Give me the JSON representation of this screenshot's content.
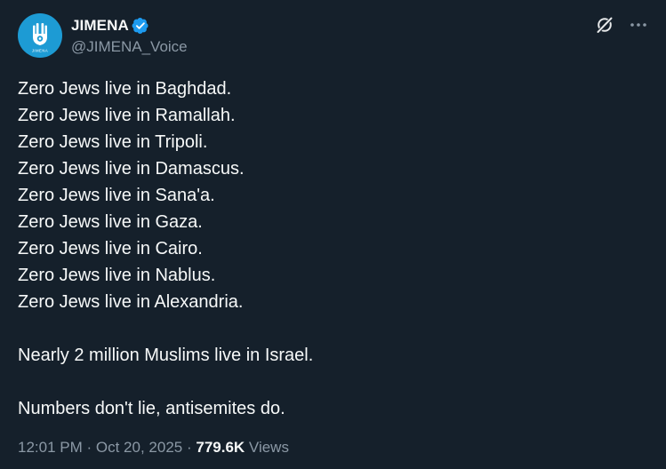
{
  "author": {
    "display_name": "JIMENA",
    "handle": "@JIMENA_Voice",
    "verified": true,
    "avatar_label": "JIMENA"
  },
  "icons": {
    "verified": "verified-badge-icon",
    "grok": "grok-icon",
    "more": "more-options-icon"
  },
  "tweet": {
    "lines": [
      "Zero Jews live in Baghdad.",
      "Zero Jews live in Ramallah.",
      "Zero Jews live in Tripoli.",
      "Zero Jews live in Damascus.",
      "Zero Jews live in Sana'a.",
      "Zero Jews live in Gaza.",
      "Zero Jews live in Cairo.",
      "Zero Jews live in Nablus.",
      "Zero Jews live in Alexandria."
    ],
    "paragraph2": "Nearly 2 million Muslims live in Israel.",
    "paragraph3": "Numbers don't lie, antisemites do."
  },
  "meta": {
    "time": "12:01 PM",
    "separator": "·",
    "date": "Oct 20, 2025",
    "views_count": "779.6K",
    "views_label": "Views"
  },
  "colors": {
    "background": "#15202b",
    "text": "#f7f9f9",
    "secondary": "#8b98a5",
    "accent": "#1d9bf0",
    "avatar_bg": "#1d9bd4"
  }
}
